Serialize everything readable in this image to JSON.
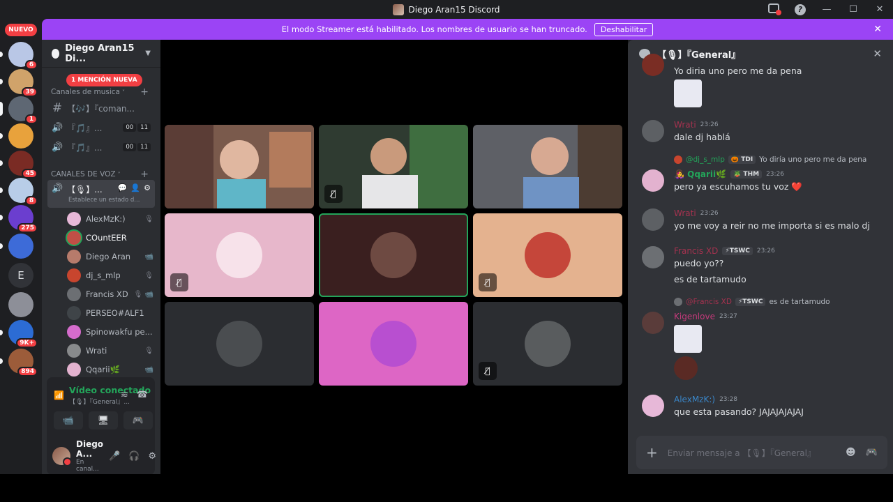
{
  "titlebar": {
    "title": "Diego Aran15 Discord",
    "help": "?",
    "minimize": "—",
    "maximize": "☐",
    "close": "✕"
  },
  "banner": {
    "text": "El modo Streamer está habilitado. Los nombres de usuario se han truncado.",
    "button": "Deshabilitar",
    "close": "✕"
  },
  "rail": {
    "nuevo": "NUEVO",
    "servers": [
      {
        "badge": "6",
        "color": "#b9c7e6"
      },
      {
        "badge": "39",
        "color": "#d0a36a"
      },
      {
        "badge": "1",
        "color": "#5e6773"
      },
      {
        "badge": "",
        "color": "#e8a23c"
      },
      {
        "badge": "45",
        "color": "#7a2b24"
      },
      {
        "badge": "8",
        "color": "#b8cde8"
      },
      {
        "badge": "275",
        "color": "#6b3ecf"
      },
      {
        "badge": "",
        "color": "#3d6bd8"
      },
      {
        "letter": "E"
      },
      {
        "badge": "",
        "color": "#8d8f98"
      },
      {
        "badge": "9K+",
        "color": "#2c6cd4"
      },
      {
        "badge": "894",
        "color": "#9c5c3a"
      }
    ]
  },
  "sidebar": {
    "guild_name": "Diego Aran15 Di...",
    "mention_pill": "1 MENCIÓN NUEVA",
    "category_music": "Canales de musica",
    "category_voice": "CANALES DE VOZ",
    "channels": [
      {
        "icon": "#",
        "name": "【🎶】『coman..."
      },
      {
        "icon": "🔊",
        "name": "『🎵』...",
        "count_a": "00",
        "count_b": "11"
      },
      {
        "icon": "🔊",
        "name": "『🎵』...",
        "count_a": "00",
        "count_b": "11"
      }
    ],
    "active_voice": {
      "name": "【🎙】...",
      "status": "Establece un estado d..."
    },
    "members": [
      {
        "name": "AlexMzK:)",
        "icon": "🎙",
        "color": "#e7b8d8",
        "bright": false
      },
      {
        "name": "COuntEER",
        "icon": "",
        "color": "#c14f46",
        "bright": true
      },
      {
        "name": "Diego Aran",
        "icon": "📹",
        "color": "#b77b6b",
        "bright": false
      },
      {
        "name": "dj_s_mlp",
        "icon": "🎙",
        "color": "#c8452e",
        "bright": false
      },
      {
        "name": "Francis XD",
        "icon": "🎙 📹",
        "color": "#6c6f73",
        "bright": false
      },
      {
        "name": "PERSEO#ALF1",
        "icon": "",
        "color": "#3f4448",
        "bright": false
      },
      {
        "name": "Spinowakfu pe...",
        "icon": "",
        "color": "#d56ccc",
        "bright": false
      },
      {
        "name": "Wrati",
        "icon": "🎙",
        "color": "#888a8c",
        "bright": false
      },
      {
        "name": "Qqarii🌿",
        "icon": "📹",
        "color": "#e3b2cf",
        "bright": false
      }
    ],
    "voice_panel": {
      "status": "Vídeo conectado",
      "channel": "【🎙】『General』...",
      "user_name": "Diego A...",
      "user_status": "En canal..."
    }
  },
  "video_tiles": [
    {
      "label": "webcam-1",
      "bg": "#8f6c5a",
      "avatar": "",
      "muted": false,
      "selected": false
    },
    {
      "label": "webcam-2",
      "bg": "#3a4a3a",
      "avatar": "",
      "muted": true,
      "selected": false
    },
    {
      "label": "webcam-3",
      "bg": "#6a6f76",
      "avatar": "",
      "muted": false,
      "selected": false
    },
    {
      "label": "pink-avatar",
      "bg": "#e7b7cb",
      "avatar": "#f7e2ea",
      "muted": true,
      "selected": false
    },
    {
      "label": "brown-avatar",
      "bg": "#3a1f1f",
      "avatar": "#6e4a42",
      "muted": false,
      "selected": true
    },
    {
      "label": "peach-avatar",
      "bg": "#e4b28f",
      "avatar": "#c5463a",
      "muted": true,
      "selected": false
    },
    {
      "label": "dark-avatar-1",
      "bg": "#2b2d31",
      "avatar": "#4a4d50",
      "muted": false,
      "selected": false
    },
    {
      "label": "magenta-avatar",
      "bg": "#dd66c5",
      "avatar": "#b84fd0",
      "muted": false,
      "selected": false
    },
    {
      "label": "dark-avatar-2",
      "bg": "#2b2d31",
      "avatar": "#595c5e",
      "muted": true,
      "selected": false
    }
  ],
  "chat": {
    "header": "【🎙】『General』",
    "close": "✕",
    "messages": [
      {
        "text": "Yo diria uno pero me da pena"
      },
      {
        "author": "Wrati",
        "author_color": "#a5324f",
        "time": "23:26",
        "text": "dale dj hablá"
      },
      {
        "reply_author": "@dj_s_mlp",
        "reply_tag": "🎃 TDI",
        "reply_text": "Yo diría uno pero me da pena",
        "author": "👩‍🎤 Qqarii🌿",
        "author_color": "#23a55a",
        "tag": "🪴 THM",
        "time": "23:26",
        "text": "pero ya escuhamos tu voz ❤️"
      },
      {
        "author": "Wrati",
        "author_color": "#a5324f",
        "time": "23:26",
        "text": "yo me voy a reir no me importa si es malo dj"
      },
      {
        "author": "Francis XD",
        "author_color": "#a5324f",
        "tag": "⚡TSWC",
        "time": "23:26",
        "text": "puedo yo??",
        "text2": "es de tartamudo"
      },
      {
        "reply_author": "@Francis XD",
        "reply_tag": "⚡TSWC",
        "reply_text": "es de tartamudo",
        "author": "Kigenlove",
        "author_color": "#c33a7a",
        "time": "23:27"
      },
      {
        "author": "AlexMzK:)",
        "author_color": "#3a86c8",
        "time": "23:28",
        "text": "que esta pasando? JAJAJAJAJAJ"
      }
    ],
    "composer_placeholder": "Enviar mensaje a 【🎙】『General』"
  }
}
